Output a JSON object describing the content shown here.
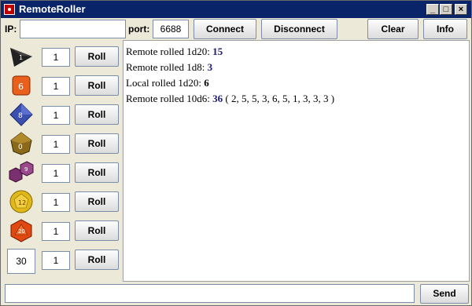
{
  "window": {
    "title": "RemoteRoller"
  },
  "toolbar": {
    "ip_label": "IP:",
    "ip_value": "",
    "port_label": "port:",
    "port_value": "6688",
    "connect_label": "Connect",
    "disconnect_label": "Disconnect",
    "clear_label": "Clear",
    "info_label": "Info"
  },
  "dice": [
    {
      "icon": "d4-icon",
      "count": "1",
      "roll_label": "Roll",
      "color": "#2a2a2a"
    },
    {
      "icon": "d6-icon",
      "count": "1",
      "roll_label": "Roll",
      "color": "#e8601c"
    },
    {
      "icon": "d8-icon",
      "count": "1",
      "roll_label": "Roll",
      "color": "#3a4fb0"
    },
    {
      "icon": "d10-icon",
      "count": "1",
      "roll_label": "Roll",
      "color": "#8a6a1a"
    },
    {
      "icon": "d12-pair-icon",
      "count": "1",
      "roll_label": "Roll",
      "color": "#7a3070"
    },
    {
      "icon": "d12-icon",
      "count": "1",
      "roll_label": "Roll",
      "color": "#e0b81a"
    },
    {
      "icon": "d20-icon",
      "count": "1",
      "roll_label": "Roll",
      "color": "#e04a10"
    },
    {
      "custom_sides": "30",
      "count": "1",
      "roll_label": "Roll"
    }
  ],
  "log": [
    {
      "prefix": "Remote rolled 1d20: ",
      "result": "15",
      "suffix": "",
      "local": false
    },
    {
      "prefix": "Remote rolled 1d8: ",
      "result": "3",
      "suffix": "",
      "local": false
    },
    {
      "prefix": "Local rolled 1d20: ",
      "result": "6",
      "suffix": "",
      "local": true
    },
    {
      "prefix": "Remote rolled 10d6: ",
      "result": "36",
      "suffix": " ( 2, 5, 5, 3, 6, 5, 1, 3, 3, 3 )",
      "local": false
    }
  ],
  "bottom": {
    "chat_value": "",
    "send_label": "Send"
  }
}
